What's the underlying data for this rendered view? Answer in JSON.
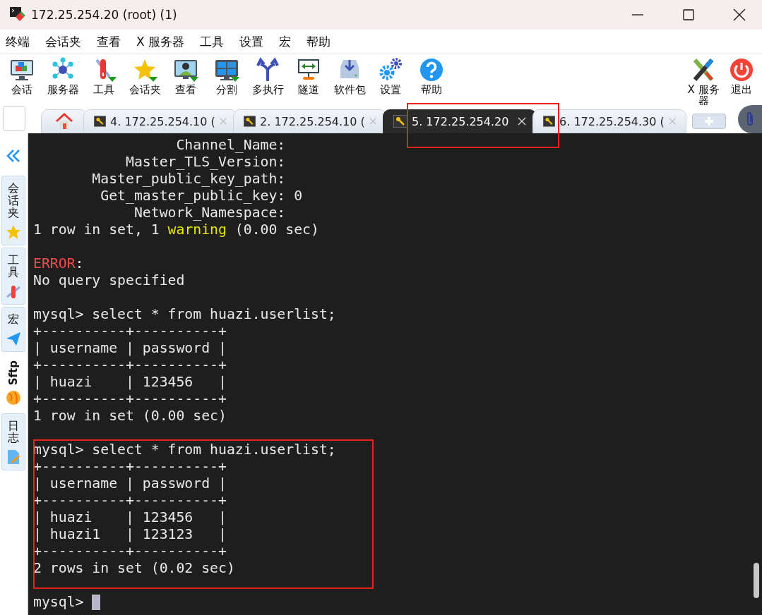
{
  "window": {
    "title": "172.25.254.20 (root) (1)"
  },
  "menu": [
    "终端",
    "会话夹",
    "查看",
    "X 服务器",
    "工具",
    "设置",
    "宏",
    "帮助"
  ],
  "toolbar": [
    {
      "label": "会话",
      "kind": "session",
      "dropdown": false
    },
    {
      "label": "服务器",
      "kind": "servers",
      "dropdown": false
    },
    {
      "label": "工具",
      "kind": "tools",
      "dropdown": true
    },
    {
      "label": "会话夹",
      "kind": "star",
      "dropdown": true
    },
    {
      "label": "查看",
      "kind": "view",
      "dropdown": true
    },
    {
      "label": "分割",
      "kind": "split",
      "dropdown": true
    },
    {
      "label": "多执行",
      "kind": "multiexec",
      "dropdown": false
    },
    {
      "label": "隧道",
      "kind": "tunnel",
      "dropdown": false
    },
    {
      "label": "软件包",
      "kind": "packages",
      "dropdown": false
    },
    {
      "label": "设置",
      "kind": "settings",
      "dropdown": false
    },
    {
      "label": "帮助",
      "kind": "help",
      "dropdown": false
    }
  ],
  "toolbar_right": [
    {
      "label": "X 服务器",
      "kind": "xserver",
      "dropdown": false
    },
    {
      "label": "退出",
      "kind": "exit",
      "dropdown": false
    }
  ],
  "tabs": [
    {
      "kind": "home",
      "selected": false,
      "highlighted": false
    },
    {
      "kind": "ssh",
      "label": "4. 172.25.254.10 (",
      "selected": false,
      "highlighted": false
    },
    {
      "kind": "ssh",
      "label": "2. 172.25.254.10 (",
      "selected": false,
      "highlighted": false
    },
    {
      "kind": "ssh",
      "label": "5. 172.25.254.20",
      "selected": true,
      "highlighted": true
    },
    {
      "kind": "ssh",
      "label": "6. 172.25.254.30 (",
      "selected": false,
      "highlighted": false
    }
  ],
  "sidebar": [
    {
      "label": "会话夹",
      "kind": "star",
      "selected": false
    },
    {
      "label": "工具",
      "kind": "tools",
      "selected": false
    },
    {
      "label": "宏",
      "kind": "macro",
      "selected": false
    },
    {
      "label": "Sftp",
      "kind": "sftp",
      "selected": true
    },
    {
      "label": "日志",
      "kind": "log",
      "selected": false
    }
  ],
  "terminal": {
    "blocks": [
      {
        "highlighted": false,
        "cursor": false,
        "lines": [
          [
            {
              "text": "                 Channel_Name:",
              "kind": "plain"
            }
          ],
          [
            {
              "text": "           Master_TLS_Version:",
              "kind": "plain"
            }
          ],
          [
            {
              "text": "       Master_public_key_path:",
              "kind": "plain"
            }
          ],
          [
            {
              "text": "        Get_master_public_key: 0",
              "kind": "plain"
            }
          ],
          [
            {
              "text": "            Network_Namespace:",
              "kind": "plain"
            }
          ],
          [
            {
              "text": "1 row in set, 1 ",
              "kind": "plain"
            },
            {
              "text": "warning",
              "kind": "warning"
            },
            {
              "text": " (0.00 sec)",
              "kind": "plain"
            }
          ]
        ]
      },
      {
        "highlighted": false,
        "cursor": false,
        "lines": [
          [
            {
              "text": "ERROR",
              "kind": "error"
            },
            {
              "text": ":",
              "kind": "plain"
            }
          ],
          [
            {
              "text": "No query specified",
              "kind": "plain"
            }
          ]
        ]
      },
      {
        "highlighted": false,
        "cursor": false,
        "lines": [
          [
            {
              "text": "mysql> select * from huazi.userlist;",
              "kind": "plain"
            }
          ],
          [
            {
              "text": "+----------+----------+",
              "kind": "plain"
            }
          ],
          [
            {
              "text": "| username | password |",
              "kind": "plain"
            }
          ],
          [
            {
              "text": "+----------+----------+",
              "kind": "plain"
            }
          ],
          [
            {
              "text": "| huazi    | 123456   |",
              "kind": "plain"
            }
          ],
          [
            {
              "text": "+----------+----------+",
              "kind": "plain"
            }
          ],
          [
            {
              "text": "1 row in set (0.00 sec)",
              "kind": "plain"
            }
          ]
        ]
      },
      {
        "highlighted": true,
        "cursor": false,
        "lines": [
          [
            {
              "text": "mysql> select * from huazi.userlist;",
              "kind": "plain"
            }
          ],
          [
            {
              "text": "+----------+----------+",
              "kind": "plain"
            }
          ],
          [
            {
              "text": "| username | password |",
              "kind": "plain"
            }
          ],
          [
            {
              "text": "+----------+----------+",
              "kind": "plain"
            }
          ],
          [
            {
              "text": "| huazi    | 123456   |",
              "kind": "plain"
            }
          ],
          [
            {
              "text": "| huazi1   | 123123   |",
              "kind": "plain"
            }
          ],
          [
            {
              "text": "+----------+----------+",
              "kind": "plain"
            }
          ],
          [
            {
              "text": "2 rows in set (0.02 sec)",
              "kind": "plain"
            }
          ]
        ]
      },
      {
        "highlighted": false,
        "cursor": true,
        "lines": [
          [
            {
              "text": "mysql> ",
              "kind": "plain"
            }
          ]
        ]
      }
    ]
  }
}
